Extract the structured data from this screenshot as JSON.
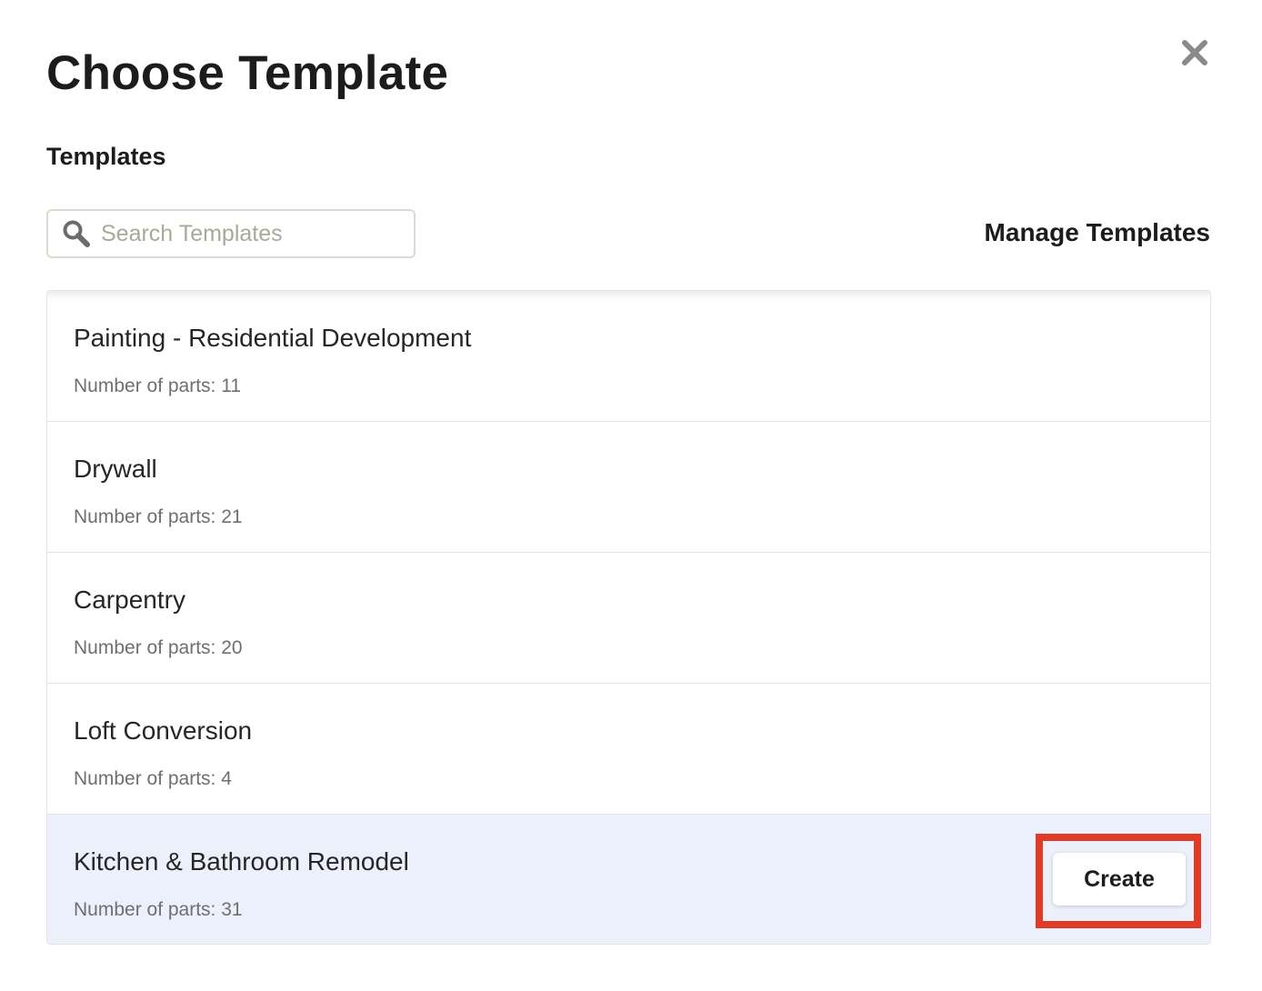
{
  "dialog": {
    "title": "Choose Template",
    "section_label": "Templates",
    "close_icon": "close-icon"
  },
  "search": {
    "placeholder": "Search Templates",
    "value": "",
    "icon": "search-icon"
  },
  "manage_link": "Manage Templates",
  "templates": [
    {
      "name": "Painting - Residential Development",
      "parts": "Number of parts: 11",
      "selected": false
    },
    {
      "name": "Drywall",
      "parts": "Number of parts: 21",
      "selected": false
    },
    {
      "name": "Carpentry",
      "parts": "Number of parts: 20",
      "selected": false
    },
    {
      "name": "Loft Conversion",
      "parts": "Number of parts: 4",
      "selected": false
    },
    {
      "name": "Kitchen & Bathroom Remodel",
      "parts": "Number of parts: 31",
      "selected": true
    }
  ],
  "create_button": "Create",
  "colors": {
    "selected_row": "#ecf0fa",
    "highlight_border": "#e03b24",
    "search_border": "#dcdbd0"
  }
}
